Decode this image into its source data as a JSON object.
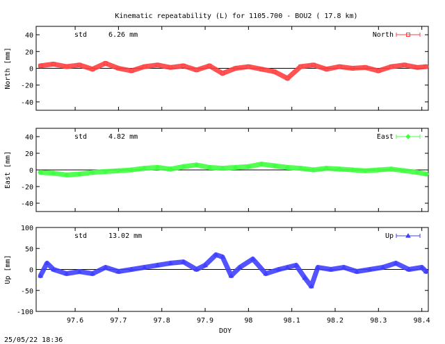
{
  "title": "Kinematic repeatability (L) for 1105.700 - BOU2  ( 17.8 km)",
  "footer_timestamp": "25/05/22 18:36",
  "chart_data": [
    {
      "type": "line",
      "name": "north",
      "series_name": "North",
      "ylabel": "North [mm]",
      "std_label": "std",
      "std_value": "6.26 mm",
      "color": "#ff4040",
      "marker": "square",
      "ylim": [
        -50,
        50
      ],
      "yticks": [
        -40,
        -20,
        0,
        20,
        40
      ],
      "xlim": [
        97.51,
        98.415
      ],
      "zero_line": true,
      "legend_position": "top-right",
      "x": [
        97.52,
        97.55,
        97.58,
        97.61,
        97.64,
        97.67,
        97.7,
        97.73,
        97.76,
        97.79,
        97.82,
        97.85,
        97.88,
        97.91,
        97.94,
        97.97,
        98.0,
        98.03,
        98.06,
        98.09,
        98.12,
        98.15,
        98.18,
        98.21,
        98.24,
        98.27,
        98.3,
        98.33,
        98.36,
        98.39,
        98.41
      ],
      "y": [
        3,
        5,
        2,
        4,
        -1,
        6,
        0,
        -3,
        2,
        4,
        1,
        3,
        -2,
        3,
        -6,
        0,
        2,
        -1,
        -4,
        -12,
        2,
        4,
        -1,
        2,
        0,
        1,
        -3,
        2,
        4,
        1,
        2
      ]
    },
    {
      "type": "line",
      "name": "east",
      "series_name": "East",
      "ylabel": "East [mm]",
      "std_label": "std",
      "std_value": "4.82 mm",
      "color": "#40ff40",
      "marker": "diamond",
      "ylim": [
        -50,
        50
      ],
      "yticks": [
        -40,
        -20,
        0,
        20,
        40
      ],
      "xlim": [
        97.51,
        98.415
      ],
      "zero_line": true,
      "legend_position": "top-right",
      "x": [
        97.52,
        97.55,
        97.58,
        97.61,
        97.64,
        97.67,
        97.7,
        97.73,
        97.76,
        97.79,
        97.82,
        97.85,
        97.88,
        97.91,
        97.94,
        97.97,
        98.0,
        98.03,
        98.06,
        98.09,
        98.12,
        98.15,
        98.18,
        98.21,
        98.24,
        98.27,
        98.3,
        98.33,
        98.36,
        98.39,
        98.41
      ],
      "y": [
        -3,
        -4,
        -6,
        -5,
        -3,
        -2,
        -1,
        0,
        2,
        3,
        1,
        4,
        6,
        3,
        2,
        3,
        4,
        7,
        5,
        3,
        2,
        0,
        2,
        1,
        0,
        -1,
        0,
        1,
        -1,
        -3,
        -5
      ]
    },
    {
      "type": "line",
      "name": "up",
      "series_name": "Up",
      "ylabel": "Up [mm]",
      "std_label": "std",
      "std_value": "13.02 mm",
      "color": "#4040ff",
      "marker": "triangle",
      "ylim": [
        -100,
        100
      ],
      "yticks": [
        -100,
        -50,
        0,
        50,
        100
      ],
      "xlim": [
        97.51,
        98.415
      ],
      "zero_line": true,
      "legend_position": "top-right",
      "xlabel": "DOY",
      "xticks": [
        97.6,
        97.7,
        97.8,
        97.9,
        98.0,
        98.1,
        98.2,
        98.3,
        98.4
      ],
      "xticklabels": [
        "97.6",
        "97.7",
        "97.8",
        "97.9",
        "98",
        "98.1",
        "98.2",
        "98.3",
        "98.4"
      ],
      "x": [
        97.52,
        97.535,
        97.55,
        97.58,
        97.61,
        97.64,
        97.67,
        97.7,
        97.73,
        97.76,
        97.79,
        97.82,
        97.85,
        97.88,
        97.9,
        97.925,
        97.94,
        97.96,
        97.98,
        98.01,
        98.04,
        98.07,
        98.09,
        98.11,
        98.13,
        98.145,
        98.16,
        98.19,
        98.22,
        98.25,
        98.28,
        98.31,
        98.34,
        98.37,
        98.4,
        98.41
      ],
      "y": [
        -15,
        15,
        0,
        -10,
        -5,
        -10,
        5,
        -5,
        0,
        5,
        10,
        15,
        18,
        0,
        10,
        35,
        30,
        -15,
        5,
        25,
        -10,
        0,
        5,
        10,
        -20,
        -40,
        5,
        0,
        5,
        -5,
        0,
        5,
        15,
        0,
        5,
        -5
      ]
    }
  ]
}
